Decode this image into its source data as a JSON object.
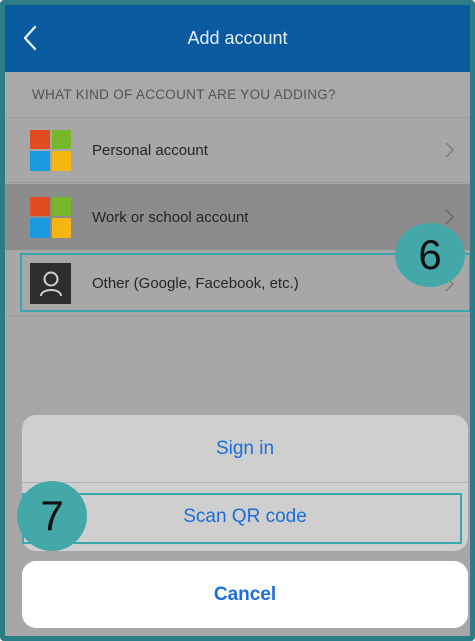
{
  "header": {
    "title": "Add account",
    "back_icon": "chevron-left-icon"
  },
  "section": {
    "title": "WHAT KIND OF ACCOUNT ARE YOU ADDING?"
  },
  "accounts": [
    {
      "label": "Personal account",
      "icon": "microsoft-logo-icon"
    },
    {
      "label": "Work or school account",
      "icon": "microsoft-logo-icon"
    },
    {
      "label": "Other (Google, Facebook, etc.)",
      "icon": "person-icon"
    }
  ],
  "callouts": {
    "step_6": "6",
    "step_7": "7"
  },
  "action_sheet": {
    "sign_in": "Sign in",
    "scan_qr": "Scan QR code",
    "cancel": "Cancel"
  },
  "colors": {
    "header_bg": "#0a5a9f",
    "accent_link": "#1a6fd9",
    "callout_teal": "#44a8a9",
    "ms_red": "#e24a1f",
    "ms_green": "#76b82a",
    "ms_blue": "#1b9ae0",
    "ms_yellow": "#f5b512"
  }
}
